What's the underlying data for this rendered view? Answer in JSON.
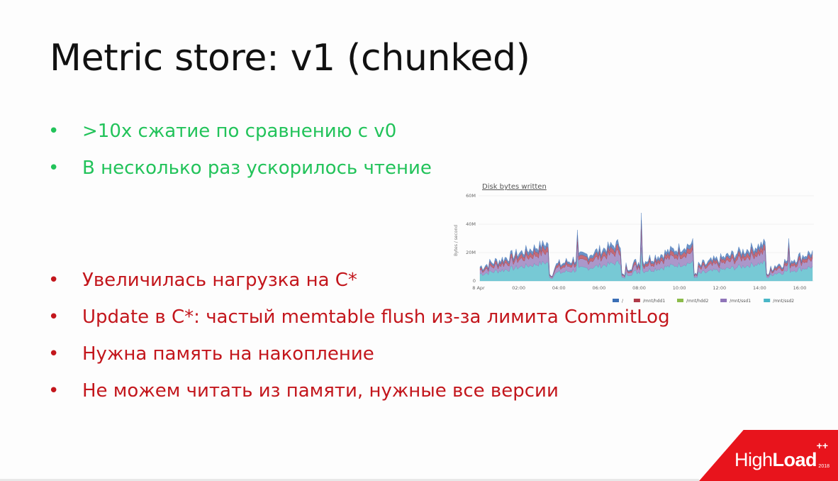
{
  "slide": {
    "title": "Metric store: v1 (chunked)",
    "pros": [
      ">10x сжатие по сравнению с v0",
      "В несколько раз ускорилось чтение"
    ],
    "cons": [
      "Увеличилась нагрузка на C*",
      "Update в C*: частый memtable flush из-за лимита CommitLog",
      "Нужна память на накопление",
      "Не можем читать из памяти, нужные все версии"
    ]
  },
  "chart_data": {
    "type": "area",
    "title": "Disk bytes written",
    "ylabel": "Bytes / second",
    "ylim": [
      0,
      60
    ],
    "yticks": [
      "0",
      "20M",
      "40M",
      "60M"
    ],
    "xticks": [
      "8 Apr",
      "02:00",
      "04:00",
      "06:00",
      "08:00",
      "10:00",
      "12:00",
      "14:00",
      "16:00"
    ],
    "legend_position": "bottom-right",
    "series": [
      {
        "name": "/",
        "color": "#3b6fb6"
      },
      {
        "name": "/mnt/hdd1",
        "color": "#b03a48"
      },
      {
        "name": "/mnt/hdd2",
        "color": "#8cbc4b"
      },
      {
        "name": "/mnt/ssd1",
        "color": "#8f74b8"
      },
      {
        "name": "/mnt/ssd2",
        "color": "#49b7c7"
      }
    ]
  },
  "brand": {
    "name_light": "High",
    "name_bold": "Load",
    "superscript": "++",
    "year": "2018"
  }
}
